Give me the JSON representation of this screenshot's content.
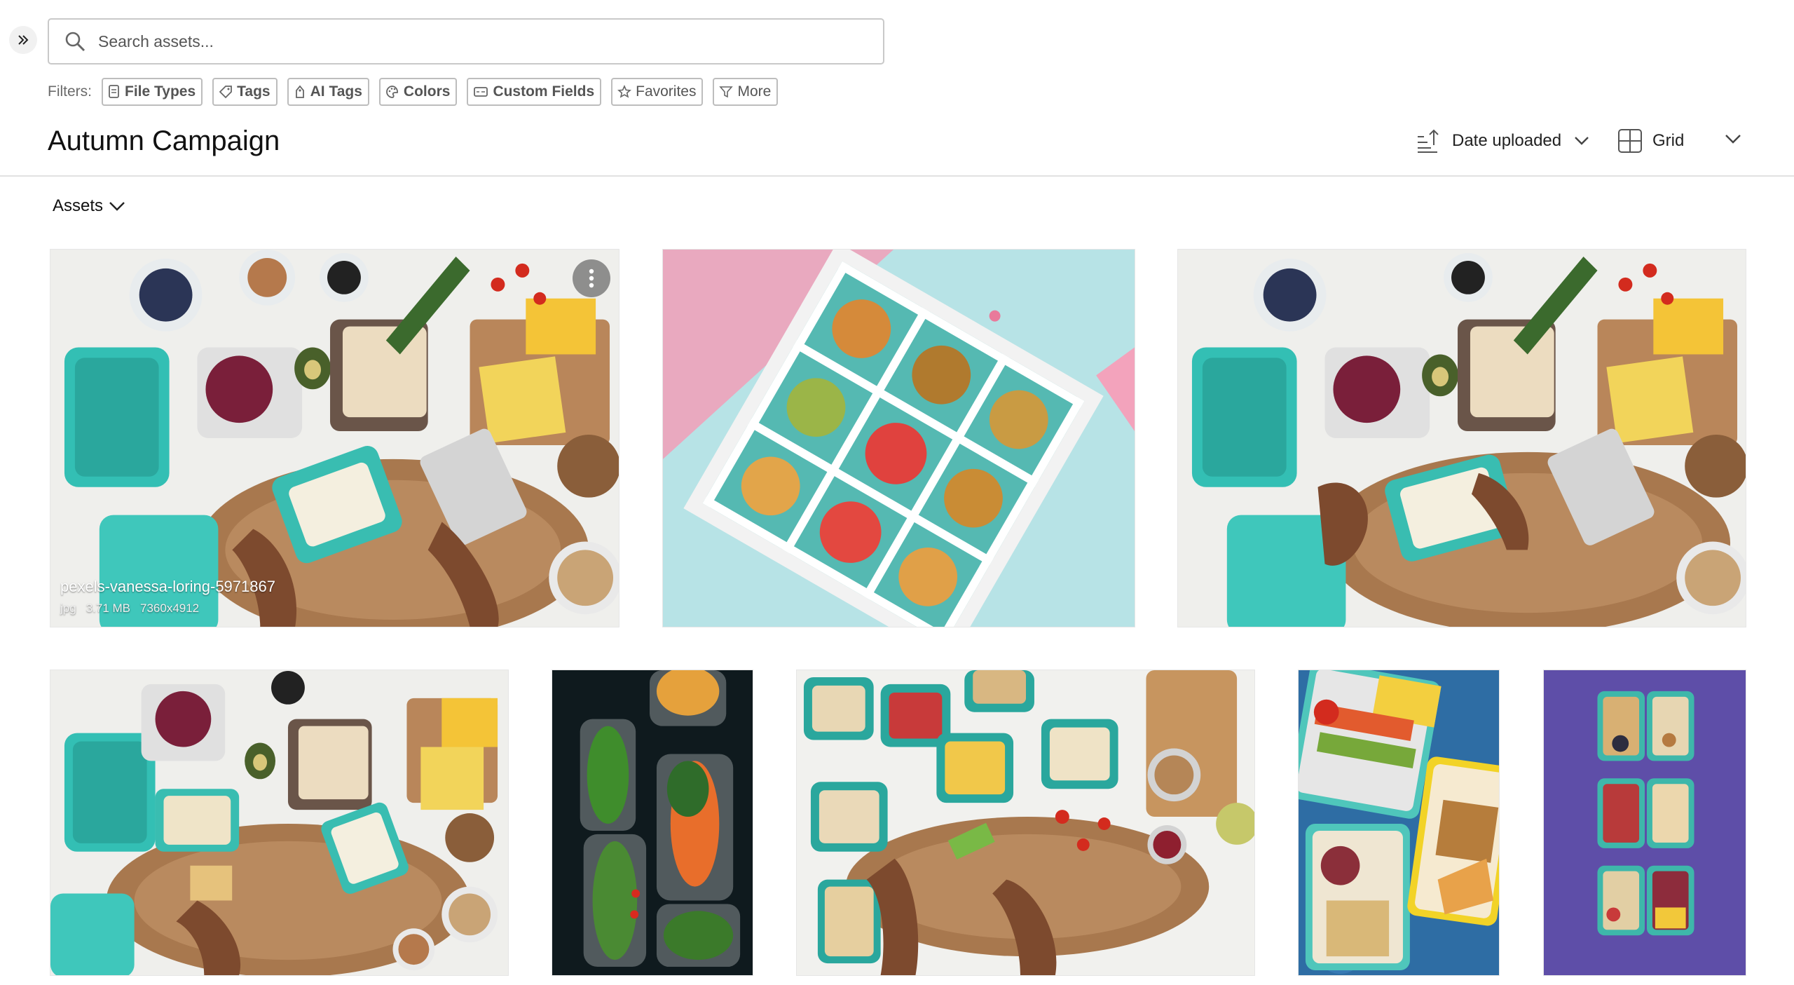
{
  "search": {
    "placeholder": "Search assets..."
  },
  "filters": {
    "label": "Filters:",
    "chips": [
      {
        "label": "File Types",
        "icon": "file-icon"
      },
      {
        "label": "Tags",
        "icon": "tag-icon"
      },
      {
        "label": "AI Tags",
        "icon": "ai-tag-icon"
      },
      {
        "label": "Colors",
        "icon": "palette-icon"
      },
      {
        "label": "Custom Fields",
        "icon": "custom-field-icon"
      },
      {
        "label": "Favorites",
        "icon": "star-icon"
      },
      {
        "label": "More",
        "icon": "filter-icon"
      }
    ]
  },
  "header": {
    "title": "Autumn Campaign",
    "sort_label": "Date uploaded",
    "view_label": "Grid"
  },
  "section": {
    "label": "Assets"
  },
  "assets": [
    {
      "name": "pexels-vanessa-loring-5971867",
      "type": "jpg",
      "size": "3.71 MB",
      "dimensions": "7360x4912"
    }
  ],
  "colors": {
    "accent_teal": "#33bfb4",
    "wood": "#a8784e",
    "background_white": "#ffffff",
    "border": "#c9c9c9"
  }
}
